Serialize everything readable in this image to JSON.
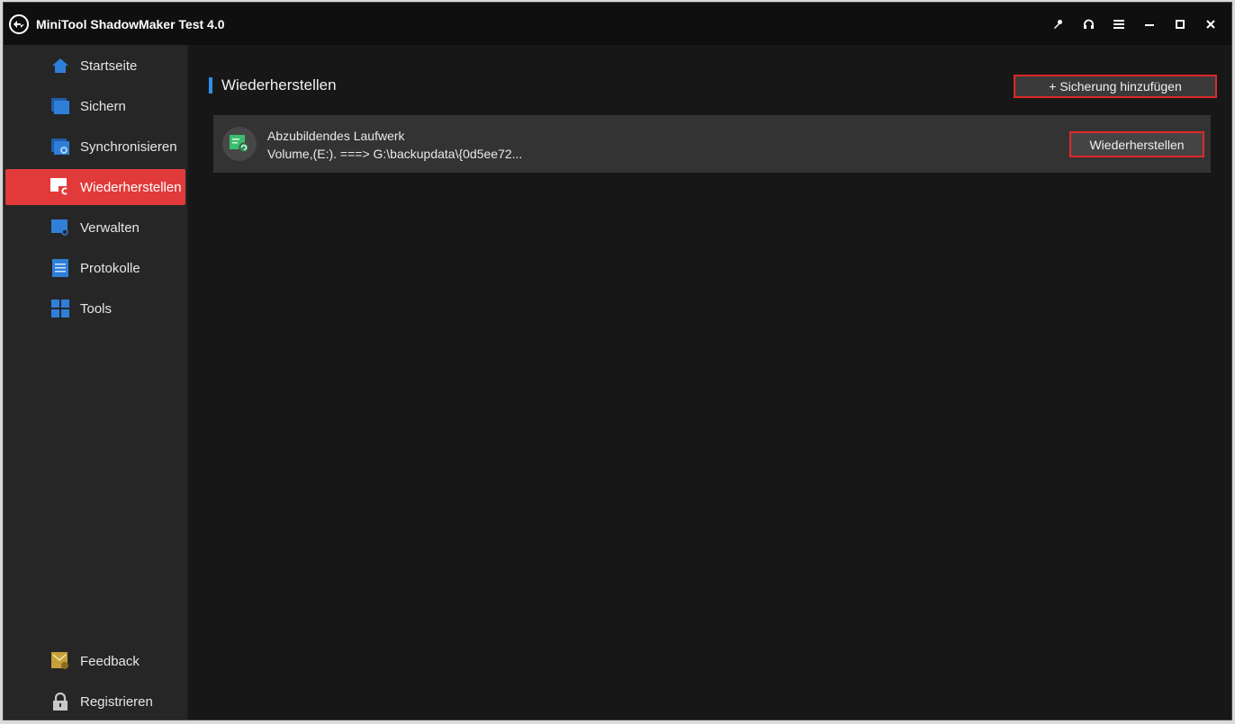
{
  "app": {
    "title": "MiniTool ShadowMaker Test 4.0"
  },
  "window_controls": [
    {
      "name": "key-icon",
      "glyph": ""
    },
    {
      "name": "headset-icon",
      "glyph": ""
    },
    {
      "name": "menu-icon",
      "glyph": ""
    },
    {
      "name": "minimize-icon",
      "glyph": "–"
    },
    {
      "name": "maximize-icon",
      "glyph": ""
    },
    {
      "name": "close-icon",
      "glyph": "×"
    }
  ],
  "sidebar": {
    "items": [
      {
        "label": "Startseite",
        "icon": "home-icon"
      },
      {
        "label": "Sichern",
        "icon": "backup-icon"
      },
      {
        "label": "Synchronisieren",
        "icon": "sync-icon"
      },
      {
        "label": "Wiederherstellen",
        "icon": "restore-icon",
        "active": true
      },
      {
        "label": "Verwalten",
        "icon": "manage-icon"
      },
      {
        "label": "Protokolle",
        "icon": "logs-icon"
      },
      {
        "label": "Tools",
        "icon": "tools-icon"
      }
    ],
    "bottom_items": [
      {
        "label": "Feedback",
        "icon": "feedback-icon"
      },
      {
        "label": "Registrieren",
        "icon": "lock-icon"
      }
    ]
  },
  "main": {
    "title": "Wiederherstellen",
    "add_backup_label": "+ Sicherung hinzufügen",
    "rows": [
      {
        "title": "Abzubildendes Laufwerk",
        "subtitle": "Volume,(E:). ===> G:\\backupdata\\{0d5ee72...",
        "action_label": "Wiederherstellen",
        "icon": "disk-restore-icon"
      }
    ]
  },
  "colors": {
    "accent_red": "#e23a3a",
    "title_accent_blue": "#2f8fe8",
    "icon_blue": "#2f7fd8",
    "icon_green": "#3bbd6e",
    "icon_gold": "#c8a03a"
  }
}
